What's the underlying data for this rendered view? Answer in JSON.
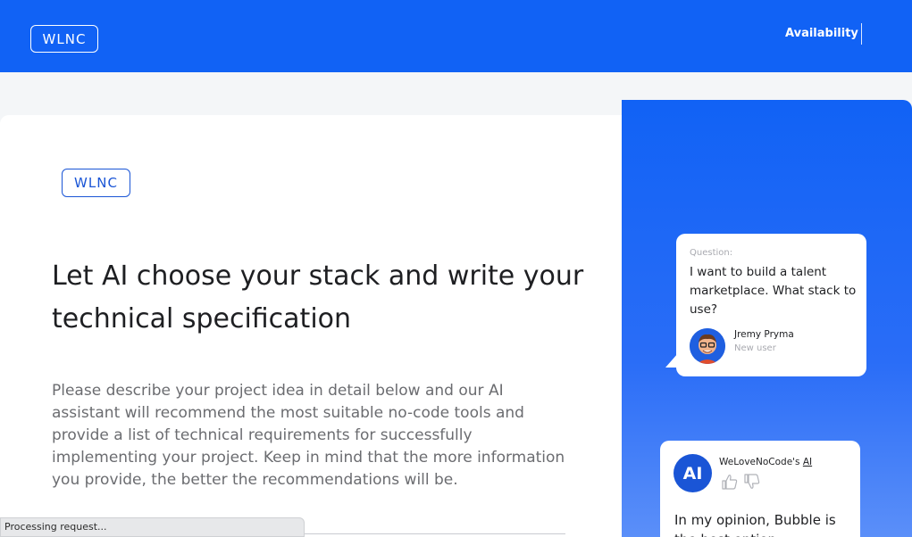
{
  "header": {
    "logo_text": "WLNC",
    "nav": [
      {
        "label": "Availability"
      }
    ]
  },
  "main": {
    "logo_text": "WLNC",
    "headline": "Let AI choose your stack and write your technical specification",
    "description": "Please describe your project idea in detail below and our AI assistant will recommend the most suitable no-code tools and provide a list of technical requirements for successfully implementing your project. Keep in mind that the more information you provide, the better the recommendations will be."
  },
  "side": {
    "question_card": {
      "label": "Question:",
      "text": "I want to build a talent marketplace. What stack to use?",
      "user_name": "Jremy Pryma",
      "user_role": "New user"
    },
    "ai_card": {
      "avatar_text": "AI",
      "name_prefix": "WeLoveNoCode's ",
      "name_link": "AI",
      "text_line1": "In my opinion, Bubble is",
      "text_line2": "the best option"
    }
  },
  "status_bar": {
    "text": "Processing request..."
  },
  "colors": {
    "brand_blue": "#1162f5",
    "accent_blue": "#1a55d6"
  }
}
